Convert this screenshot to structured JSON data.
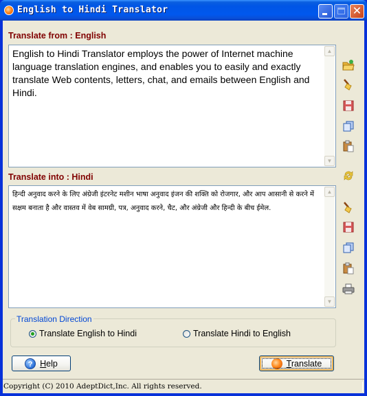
{
  "window": {
    "title": "English to Hindi Translator",
    "controls": {
      "minimize": "minimize",
      "maximize": "maximize",
      "close": "close"
    }
  },
  "source": {
    "label": "Translate from : English",
    "text": "English to Hindi Translator employs the power of Internet machine language translation engines, and enables you to easily and exactly translate Web contents, letters, chat, and emails between English and Hindi."
  },
  "target": {
    "label": "Translate into : Hindi",
    "text": "हिन्दी अनुवाद करने के लिए अंग्रेजी इंटरनेट मशीन भाषा अनुवाद इंजन की शक्ति को रोजगार, और आप आसानी से करने में सक्षम बनाता है और वास्तव में वेब सामग्री, पत्र, अनुवाद करने, चैट, और अंग्रेजी और हिन्दी के बीच ईमेल."
  },
  "side_toolbar": {
    "source_tools": [
      {
        "icon": "open-folder-icon",
        "tooltip": "Open"
      },
      {
        "icon": "clear-broom-icon",
        "tooltip": "Clear"
      },
      {
        "icon": "save-floppy-icon",
        "tooltip": "Save"
      },
      {
        "icon": "copy-icon",
        "tooltip": "Copy"
      },
      {
        "icon": "paste-icon",
        "tooltip": "Paste"
      }
    ],
    "swap_icon": "swap-refresh-icon",
    "target_tools": [
      {
        "icon": "clear-broom-icon",
        "tooltip": "Clear"
      },
      {
        "icon": "save-floppy-icon",
        "tooltip": "Save"
      },
      {
        "icon": "copy-icon",
        "tooltip": "Copy"
      },
      {
        "icon": "paste-icon",
        "tooltip": "Paste"
      },
      {
        "icon": "print-icon",
        "tooltip": "Print"
      }
    ]
  },
  "direction": {
    "title": "Translation Direction",
    "options": [
      {
        "label": "Translate English to Hindi",
        "selected": true
      },
      {
        "label": "Translate Hindi to English",
        "selected": false
      }
    ]
  },
  "buttons": {
    "help": {
      "mnemonic": "H",
      "rest": "elp"
    },
    "translate": {
      "mnemonic": "T",
      "rest": "ranslate"
    }
  },
  "status_bar": {
    "text": "Copyright (C) 2010 AdeptDict,Inc. All rights reserved."
  },
  "colors": {
    "label": "#800000",
    "group_title": "#0046d5",
    "titlebar": "#0055e5",
    "window_bg": "#ece9d8"
  }
}
